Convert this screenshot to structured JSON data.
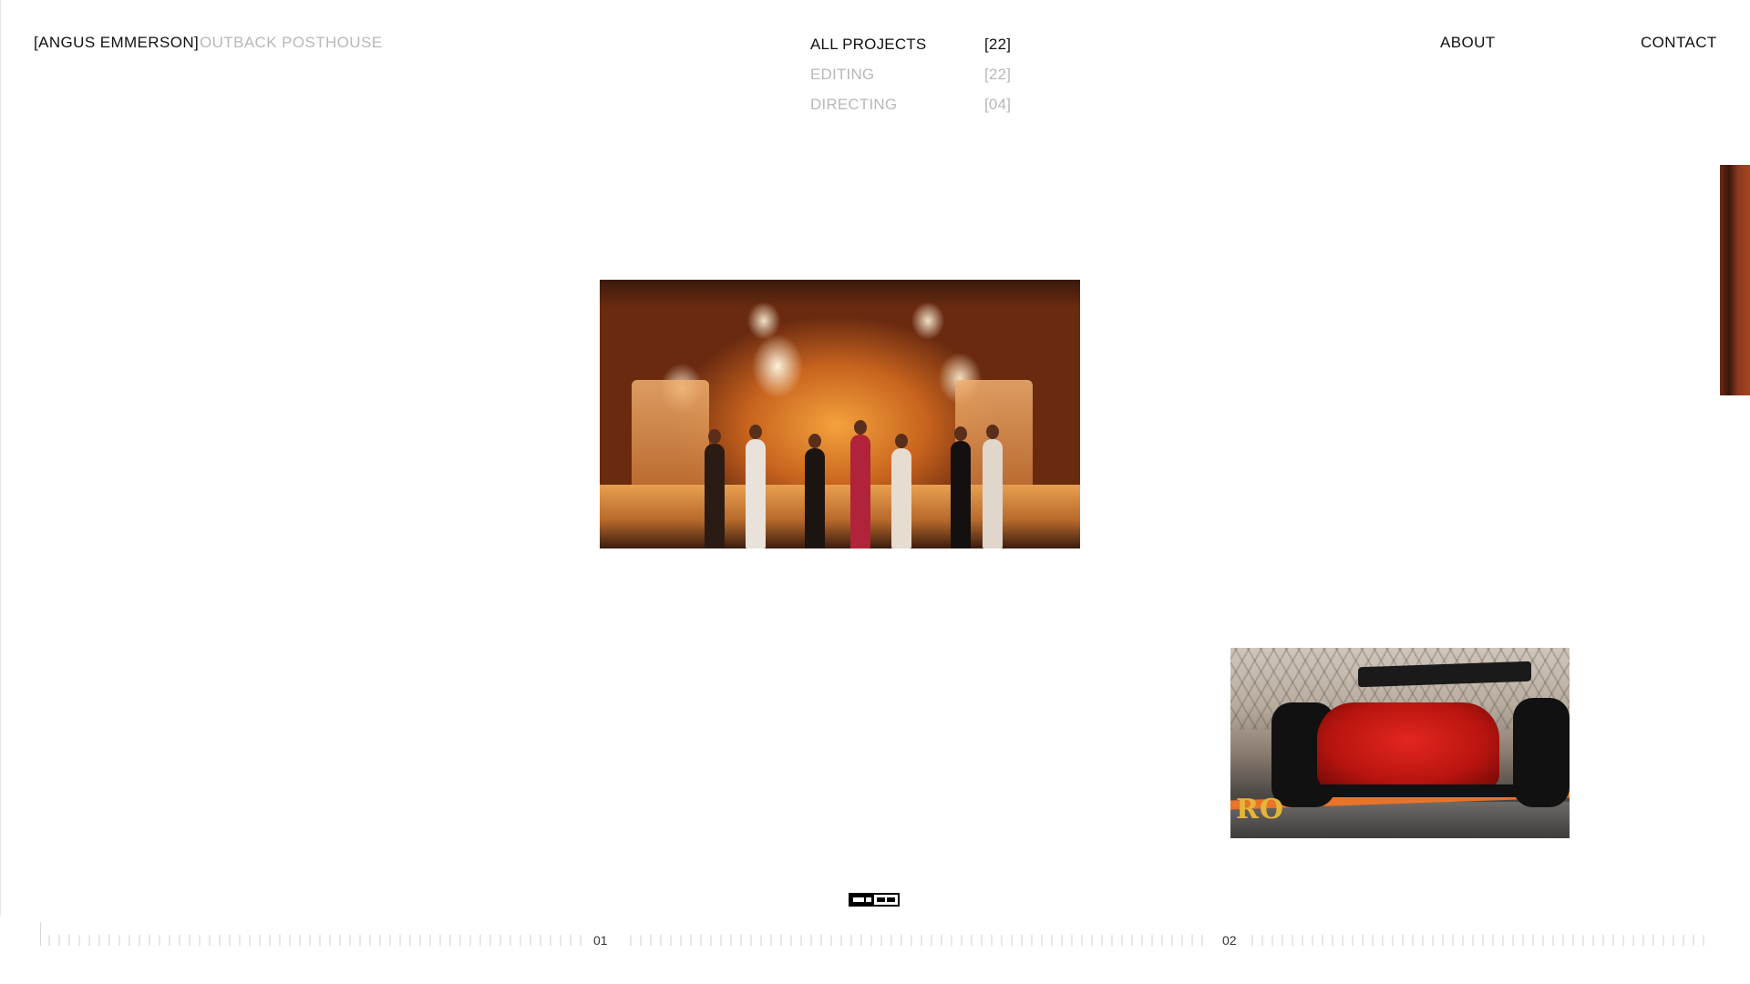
{
  "header": {
    "brand_name": "[ANGUS EMMERSON]",
    "company": "OUTBACK POSTHOUSE",
    "nav": {
      "about": "ABOUT",
      "contact": "CONTACT"
    }
  },
  "filters": [
    {
      "label": "ALL PROJECTS",
      "count": "[22]",
      "active": true
    },
    {
      "label": "EDITING",
      "count": "[22]",
      "active": false
    },
    {
      "label": "DIRECTING",
      "count": "[04]",
      "active": false
    }
  ],
  "projects": [
    {
      "name": "concert-performance-thumbnail",
      "index": "01"
    },
    {
      "name": "f1-car-thumbnail",
      "index": "02"
    }
  ],
  "timeline": {
    "markers": [
      "01",
      "02"
    ]
  },
  "colors": {
    "text": "#111111",
    "muted": "#b8b8b8",
    "background": "#ffffff"
  }
}
